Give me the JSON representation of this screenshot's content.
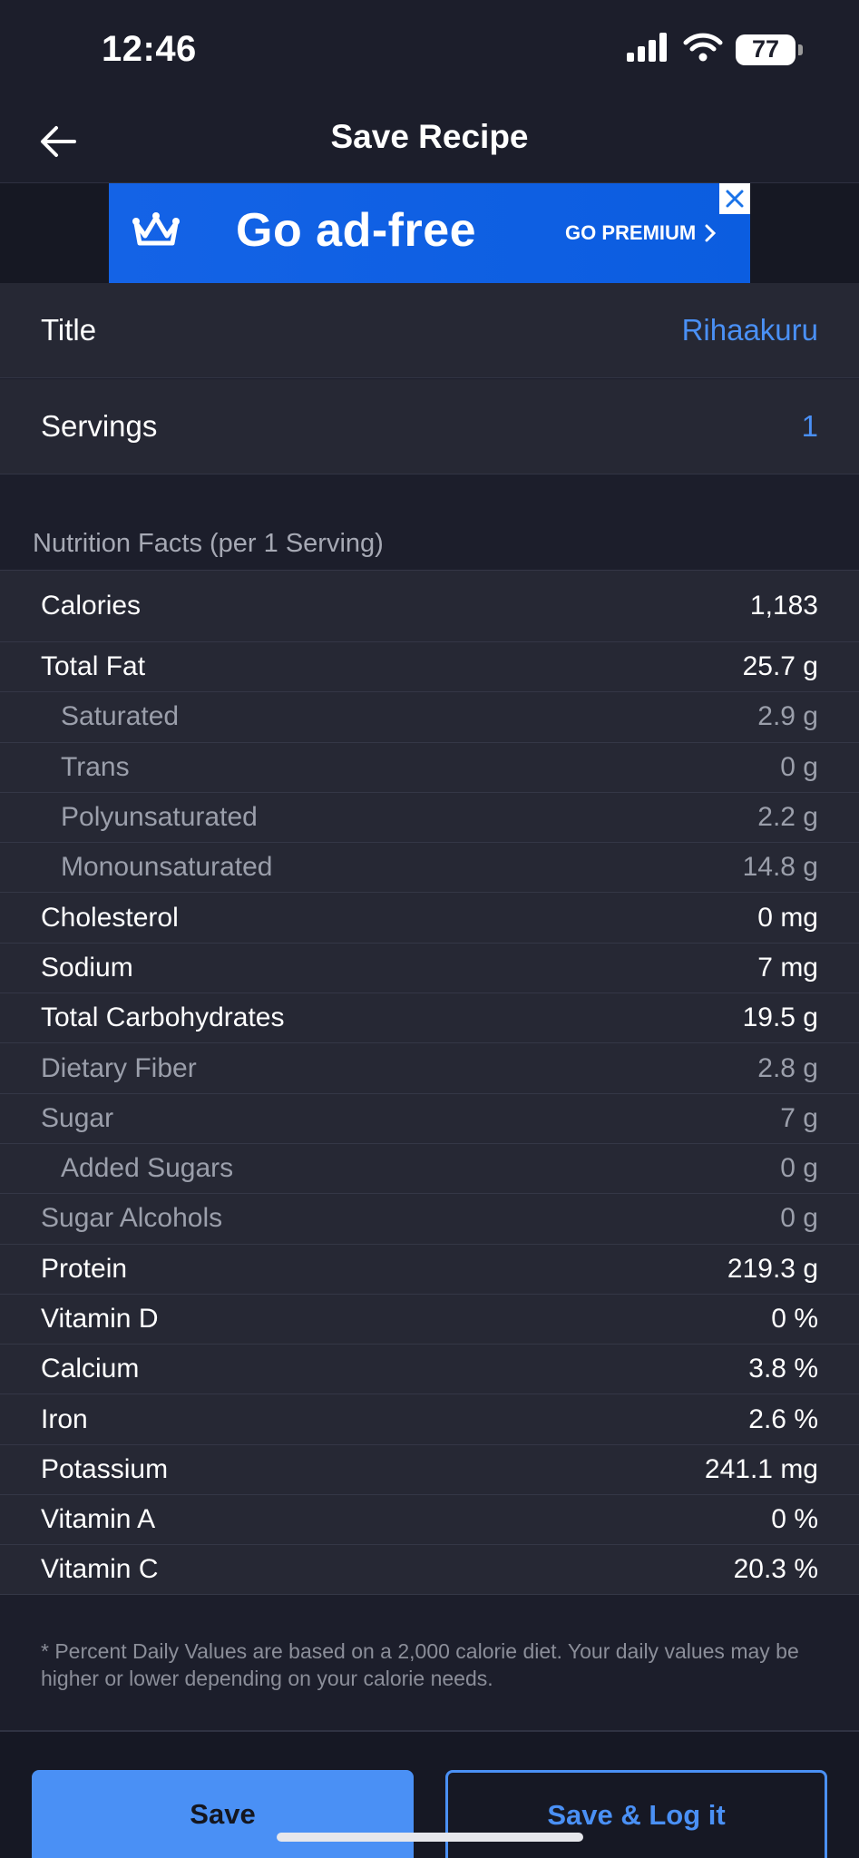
{
  "status_bar": {
    "time": "12:46",
    "battery": "77"
  },
  "nav": {
    "title": "Save Recipe",
    "back_icon": "arrow-left-icon"
  },
  "ad": {
    "headline": "Go ad-free",
    "cta": "GO PREMIUM",
    "brand_color": "#1463e6"
  },
  "fields": [
    {
      "label": "Title",
      "value": "Rihaakuru"
    },
    {
      "label": "Servings",
      "value": "1"
    }
  ],
  "nutrition": {
    "section_title": "Nutrition Facts (per 1 Serving)",
    "rows": [
      {
        "label": "Calories",
        "value": "1,183"
      },
      {
        "label": "Total Fat",
        "value": "25.7 g"
      },
      {
        "label": "Saturated",
        "value": "2.9 g"
      },
      {
        "label": "Trans",
        "value": "0 g"
      },
      {
        "label": "Polyunsaturated",
        "value": "2.2 g"
      },
      {
        "label": "Monounsaturated",
        "value": "14.8 g"
      },
      {
        "label": "Cholesterol",
        "value": "0 mg"
      },
      {
        "label": "Sodium",
        "value": "7 mg"
      },
      {
        "label": "Total Carbohydrates",
        "value": "19.5 g"
      },
      {
        "label": "Dietary Fiber",
        "value": "2.8 g"
      },
      {
        "label": "Sugar",
        "value": "7 g"
      },
      {
        "label": "Added Sugars",
        "value": "0 g"
      },
      {
        "label": "Sugar Alcohols",
        "value": "0 g"
      },
      {
        "label": "Protein",
        "value": "219.3 g"
      },
      {
        "label": "Vitamin D",
        "value": "0 %"
      },
      {
        "label": "Calcium",
        "value": "3.8 %"
      },
      {
        "label": "Iron",
        "value": "2.6 %"
      },
      {
        "label": "Potassium",
        "value": "241.1 mg"
      },
      {
        "label": "Vitamin A",
        "value": "0 %"
      },
      {
        "label": "Vitamin C",
        "value": "20.3 %"
      }
    ],
    "footnote": "* Percent Daily Values are based on a 2,000 calorie diet.  Your daily values may be higher or lower depending on your calorie needs."
  },
  "actions": {
    "save": "Save",
    "save_log": "Save & Log it"
  },
  "colors": {
    "accent": "#4a90f5",
    "background": "#1c1e2b",
    "row_bg": "#262834"
  }
}
